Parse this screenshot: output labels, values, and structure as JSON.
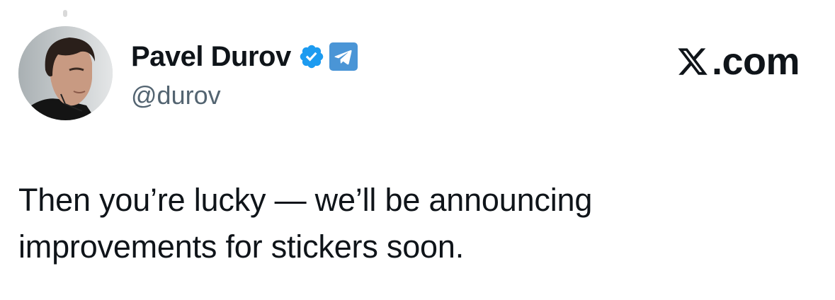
{
  "author": {
    "display_name": "Pavel Durov",
    "handle": "@durov",
    "verified_icon": "verified-badge-icon",
    "extra_badge_icon": "telegram-icon",
    "avatar": "profile-photo"
  },
  "brand": {
    "label": ".com",
    "icon": "x-logo-icon"
  },
  "tweet": {
    "lines": [
      "Then you’re lucky — we’ll be announcing",
      "improvements for stickers soon."
    ]
  },
  "colors": {
    "verified": "#1d9bf0",
    "telegram": "#4a95d6",
    "handle": "#536471",
    "text": "#0f1419"
  }
}
